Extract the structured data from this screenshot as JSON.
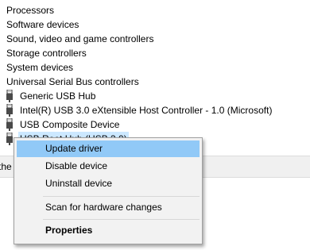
{
  "tree": {
    "categories": [
      "Processors",
      "Software devices",
      "Sound, video and game controllers",
      "Storage controllers",
      "System devices",
      "Universal Serial Bus controllers"
    ],
    "usb_children": [
      "Generic USB Hub",
      "Intel(R) USB 3.0 eXtensible Host Controller - 1.0 (Microsoft)",
      "USB Composite Device",
      "USB Root Hub (USB 3.0)"
    ],
    "selected_index": 3
  },
  "status_bar": {
    "text": "the U"
  },
  "context_menu": {
    "items": [
      "Update driver",
      "Disable device",
      "Uninstall device",
      "Scan for hardware changes",
      "Properties"
    ],
    "highlighted_index": 0,
    "bold_index": 4
  },
  "colors": {
    "menu_highlight": "#91c9f7",
    "selection": "#cce8ff",
    "menu_background": "#f2f2f2"
  },
  "icons": {
    "usb_device": "usb-plug-icon"
  }
}
